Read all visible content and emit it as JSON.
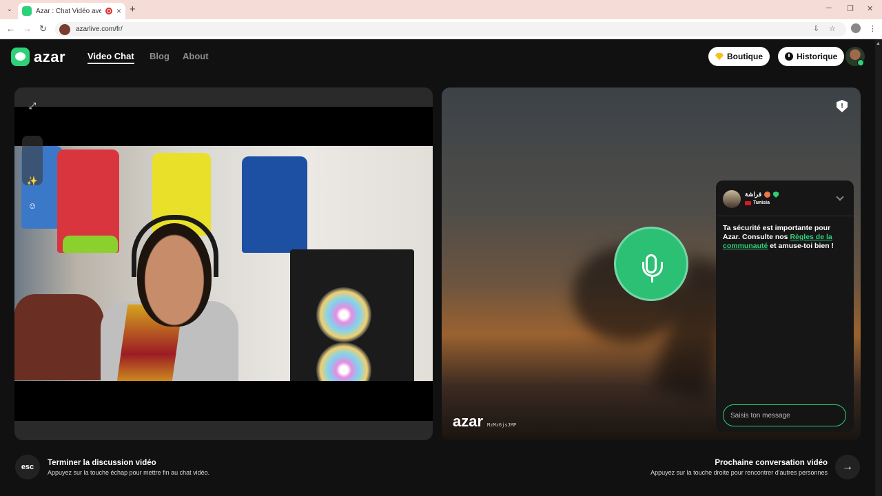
{
  "browser": {
    "tab_title": "Azar : Chat Vidéo avec de n",
    "url": "azarlive.com/fr/",
    "new_tab": "+",
    "close_tab": "×",
    "menu": "⌄"
  },
  "header": {
    "logo_text": "azar",
    "nav": [
      "Video Chat",
      "Blog",
      "About"
    ],
    "shop_label": "Boutique",
    "history_label": "Historique"
  },
  "video_right": {
    "report_icon": "!",
    "watermark_logo": "azar",
    "watermark_id": "MzMz6jsJMP"
  },
  "chat": {
    "name": "فراشة",
    "country": "Tunisia",
    "message_part1": "Ta sécurité est importante pour Azar. Consulte nos ",
    "message_link": "Règles de la communauté",
    "message_part2": " et amuse-toi bien !",
    "input_placeholder": "Saisis ton message"
  },
  "footer": {
    "esc_label": "esc",
    "end_title": "Terminer la discussion vidéo",
    "end_sub": "Appuyez sur la touche échap pour mettre fin au chat vidéo.",
    "next_title": "Prochaine conversation vidéo",
    "next_sub": "Appuyez sur la touche droite pour rencontrer d'autres personnes",
    "next_arrow": "→"
  },
  "colors": {
    "accent": "#2fd07a",
    "background": "#111111"
  }
}
